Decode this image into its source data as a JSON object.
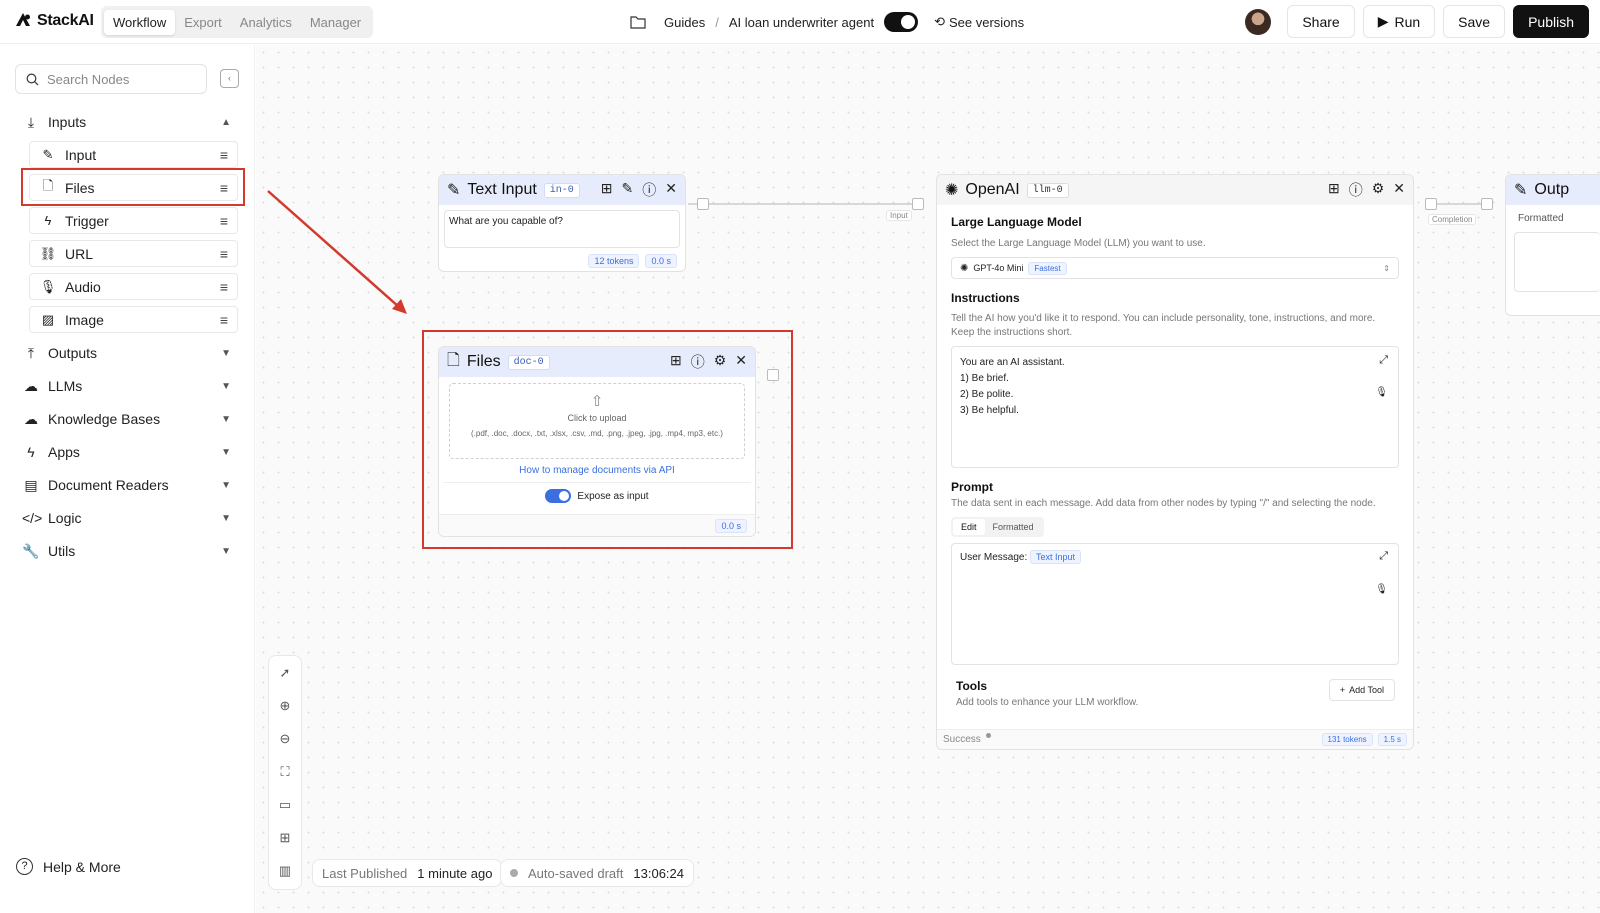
{
  "app": {
    "name": "StackAI"
  },
  "tabs": [
    "Workflow",
    "Export",
    "Analytics",
    "Manager"
  ],
  "breadcrumb": {
    "folder": "Guides",
    "separator": "/",
    "project": "AI loan underwriter agent",
    "versions": "See versions"
  },
  "actions": {
    "share": "Share",
    "run": "Run",
    "save": "Save",
    "publish": "Publish"
  },
  "sidebar": {
    "search_placeholder": "Search Nodes",
    "inputs_label": "Inputs",
    "input_items": [
      {
        "label": "Input",
        "icon": "pencil-icon"
      },
      {
        "label": "Files",
        "icon": "file-icon"
      },
      {
        "label": "Trigger",
        "icon": "bolt-icon"
      },
      {
        "label": "URL",
        "icon": "link-icon"
      },
      {
        "label": "Audio",
        "icon": "mic-icon"
      },
      {
        "label": "Image",
        "icon": "image-icon"
      }
    ],
    "categories": [
      {
        "label": "Outputs",
        "icon": "upload-icon"
      },
      {
        "label": "LLMs",
        "icon": "llm-icon"
      },
      {
        "label": "Knowledge Bases",
        "icon": "cloud-icon"
      },
      {
        "label": "Apps",
        "icon": "bolt-icon"
      },
      {
        "label": "Document Readers",
        "icon": "doc-icon"
      },
      {
        "label": "Logic",
        "icon": "code-icon"
      },
      {
        "label": "Utils",
        "icon": "wrench-icon"
      }
    ],
    "help": "Help & More"
  },
  "text_input_node": {
    "title": "Text Input",
    "tag": "in-0",
    "value": "What are you capable of?",
    "tokens": "12 tokens",
    "time": "0.0 s"
  },
  "files_node": {
    "title": "Files",
    "tag": "doc-0",
    "upload": "Click to upload",
    "formats": "(.pdf, .doc, .docx, .txt, .xlsx, .csv, .md, .png, .jpeg, .jpg, .mp4, mp3, etc.)",
    "api_link": "How to manage documents via API",
    "expose": "Expose as input",
    "time": "0.0 s"
  },
  "edge_labels": {
    "input": "Input",
    "completion": "Completion"
  },
  "openai_node": {
    "title": "OpenAI",
    "tag": "llm-0",
    "llm_label": "Large Language Model",
    "llm_desc": "Select the Large Language Model (LLM) you want to use.",
    "model": "GPT-4o Mini",
    "model_badge": "Fastest",
    "instructions_label": "Instructions",
    "instructions_desc": "Tell the AI how you'd like it to respond. You can include personality, tone, instructions, and more. Keep the instructions short.",
    "instructions": [
      "You are an AI assistant.",
      "1) Be brief.",
      "2) Be polite.",
      "3) Be helpful."
    ],
    "prompt_label": "Prompt",
    "prompt_desc": "The data sent in each message. Add data from other nodes by typing \"/\" and selecting the node.",
    "prompt_tabs": [
      "Edit",
      "Formatted"
    ],
    "prompt_text": "User Message:",
    "prompt_chip": "Text Input",
    "tools_label": "Tools",
    "tools_desc": "Add tools to enhance your LLM workflow.",
    "add_tool": "Add Tool",
    "status": "Success",
    "tokens": "131 tokens",
    "time": "1.5 s"
  },
  "output_node": {
    "title": "Outp",
    "sub": "Formatted"
  },
  "status_bar": {
    "published_label": "Last Published",
    "published_value": "1 minute ago",
    "autosave_label": "Auto-saved draft",
    "autosave_value": "13:06:24"
  },
  "colors": {
    "highlight": "#d23a2e",
    "node_header": "#e6ecfb",
    "accent": "#3b6fe0"
  }
}
